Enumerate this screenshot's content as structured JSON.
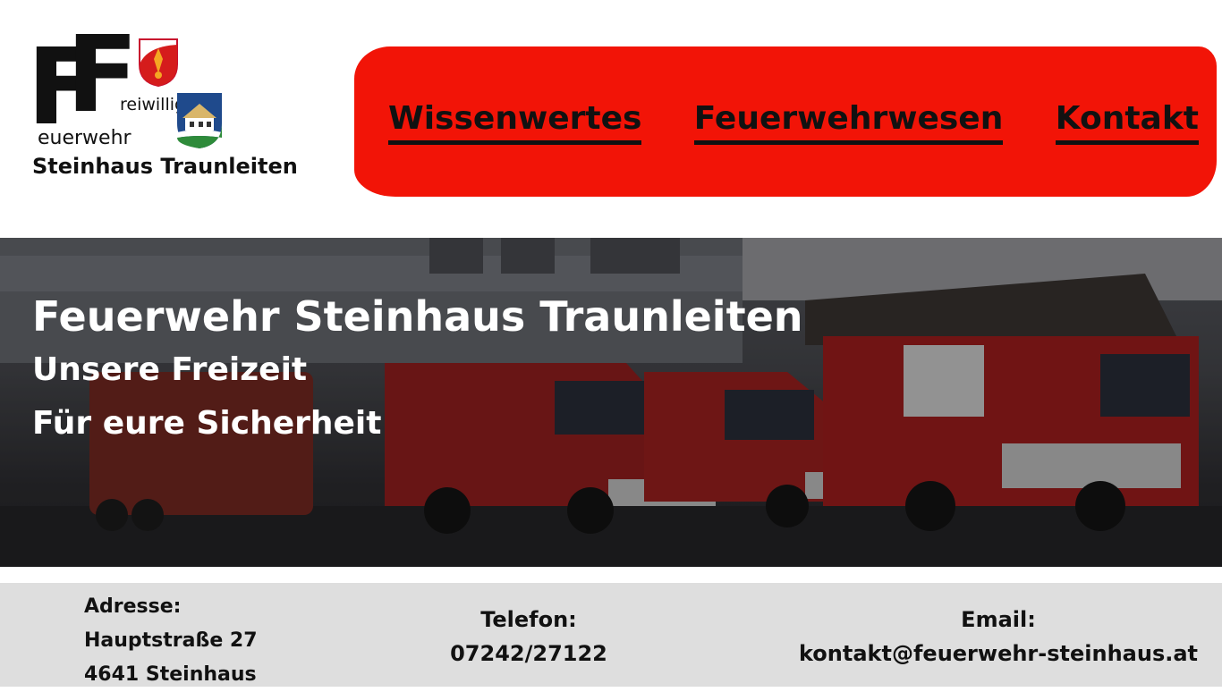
{
  "logo": {
    "big_letter": "F",
    "line1": "reiwillige",
    "line2": "euerwehr",
    "name": "Steinhaus Traunleiten"
  },
  "nav": {
    "items": [
      {
        "label": "Wissenwertes"
      },
      {
        "label": "Feuerwehrwesen"
      },
      {
        "label": "Kontakt"
      }
    ],
    "background": "#f21407"
  },
  "hero": {
    "title": "Feuerwehr Steinhaus Traunleiten",
    "subtitle1": "Unsere Freizeit",
    "subtitle2": "Für eure Sicherheit"
  },
  "footer": {
    "address_label": "Adresse:",
    "address_street": "Hauptstraße 27",
    "address_city": "4641 Steinhaus",
    "phone_label": "Telefon:",
    "phone_value": "07242/27122",
    "email_label": "Email:",
    "email_value": "kontakt@feuerwehr-steinhaus.at"
  }
}
